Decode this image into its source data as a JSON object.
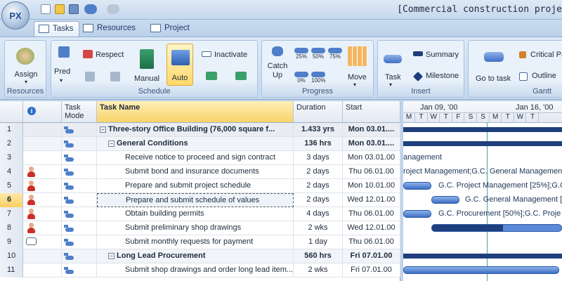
{
  "app": {
    "title": "[Commercial construction proje",
    "logo_text": "PX"
  },
  "tabs": [
    {
      "label": "Tasks",
      "icon": "tasks-icon",
      "active": true
    },
    {
      "label": "Resources",
      "icon": "resources-icon",
      "active": false
    },
    {
      "label": "Project",
      "icon": "project-icon",
      "active": false
    }
  ],
  "ribbon": {
    "resources_group": {
      "label": "Resources",
      "assign": "Assign"
    },
    "schedule_group": {
      "label": "Schedule",
      "pred": "Pred",
      "respect": "Respect",
      "inactivate": "Inactivate",
      "manual": "Manual",
      "auto": "Auto"
    },
    "progress_group": {
      "label": "Progress",
      "catch_up_1": "Catch",
      "catch_up_2": "Up",
      "move": "Move",
      "p25": "25%",
      "p50": "50%",
      "p75": "75%",
      "p0": "0%",
      "p100": "100%"
    },
    "insert_group": {
      "label": "Insert",
      "task": "Task",
      "summary": "Summary",
      "milestone": "Milestone"
    },
    "gantt_group": {
      "label": "Gantt",
      "go_to_task": "Go to task",
      "critical_path": "Critical Pa",
      "outline": "Outline"
    }
  },
  "grid": {
    "headers": {
      "task_mode_1": "Task",
      "task_mode_2": "Mode",
      "task_name": "Task Name",
      "duration": "Duration",
      "start": "Start"
    },
    "rows": [
      {
        "num": "1",
        "name": "Three-story Office Building (76,000 square f...",
        "duration": "1.433 yrs",
        "start": "Mon 03.01....",
        "summary": true,
        "level": 0,
        "resource": false,
        "note": false
      },
      {
        "num": "2",
        "name": "General Conditions",
        "duration": "136 hrs",
        "start": "Mon 03.01....",
        "summary": true,
        "level": 1,
        "resource": false,
        "note": false
      },
      {
        "num": "3",
        "name": "Receive notice to proceed and sign contract",
        "duration": "3 days",
        "start": "Mon 03.01.00",
        "summary": false,
        "level": 2,
        "resource": false,
        "note": false
      },
      {
        "num": "4",
        "name": "Submit bond and insurance documents",
        "duration": "2 days",
        "start": "Thu 06.01.00",
        "summary": false,
        "level": 2,
        "resource": true,
        "note": false
      },
      {
        "num": "5",
        "name": "Prepare and submit project schedule",
        "duration": "2 days",
        "start": "Mon 10.01.00",
        "summary": false,
        "level": 2,
        "resource": true,
        "note": false
      },
      {
        "num": "6",
        "name": "Prepare and submit schedule of values",
        "duration": "2 days",
        "start": "Wed 12.01.00",
        "summary": false,
        "level": 2,
        "resource": true,
        "note": false,
        "selected": true
      },
      {
        "num": "7",
        "name": "Obtain building permits",
        "duration": "4 days",
        "start": "Thu 06.01.00",
        "summary": false,
        "level": 2,
        "resource": true,
        "note": false
      },
      {
        "num": "8",
        "name": "Submit preliminary shop drawings",
        "duration": "2 wks",
        "start": "Wed 12.01.00",
        "summary": false,
        "level": 2,
        "resource": true,
        "note": false
      },
      {
        "num": "9",
        "name": "Submit monthly requests for payment",
        "duration": "1 day",
        "start": "Thu 06.01.00",
        "summary": false,
        "level": 2,
        "resource": false,
        "note": true
      },
      {
        "num": "10",
        "name": "Long Lead Procurement",
        "duration": "560 hrs",
        "start": "Fri 07.01.00",
        "summary": true,
        "level": 1,
        "resource": false,
        "note": false
      },
      {
        "num": "11",
        "name": "Submit shop drawings and order long lead item...",
        "duration": "2 wks",
        "start": "Fri 07.01.00",
        "summary": false,
        "level": 2,
        "resource": false,
        "note": false
      }
    ]
  },
  "gantt": {
    "week1": "Jan 09, '00",
    "week2": "Jan 16, '00",
    "days": [
      "M",
      "T",
      "W",
      "T",
      "F",
      "S",
      "S",
      "M",
      "T",
      "W",
      "T"
    ],
    "labels": {
      "row3": "anagement",
      "row4": "roject Management;G.C. General Management",
      "row5": "G.C. Project Management [25%];G.C",
      "row6": "G.C. General Management [",
      "row7": "G.C. Procurement [50%];G.C. Proje"
    }
  }
}
